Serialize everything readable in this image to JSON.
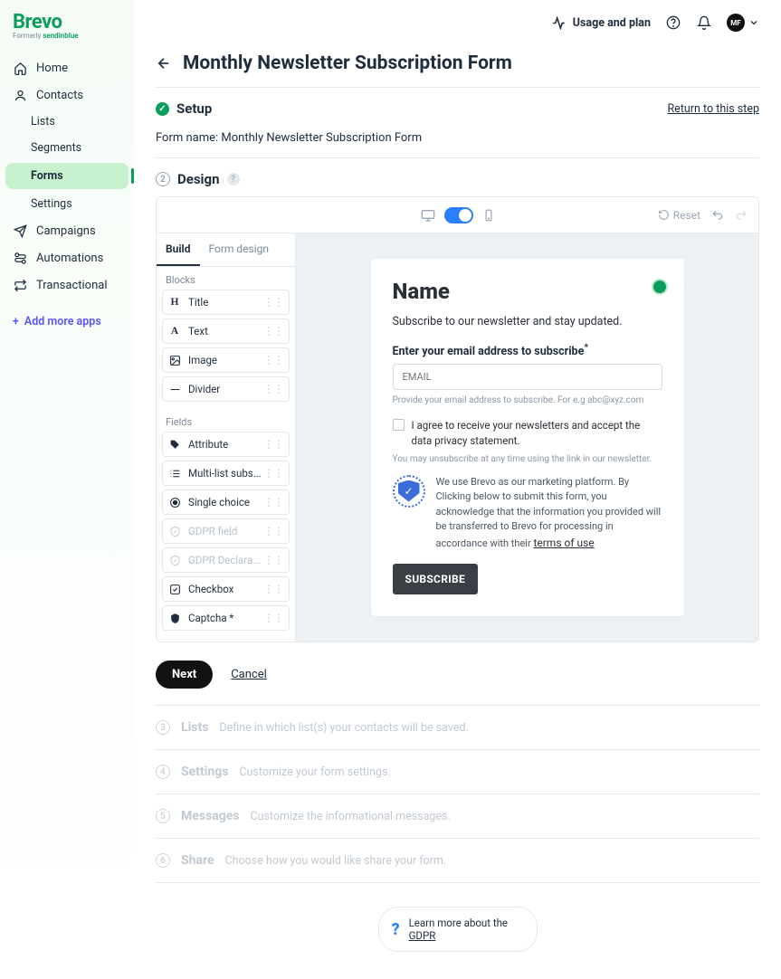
{
  "brand": {
    "name": "Brevo",
    "tagline_prefix": "Formerly ",
    "tagline_brand": "sendinblue"
  },
  "topbar": {
    "usage_label": "Usage and plan",
    "avatar_initials": "MF"
  },
  "sidebar": {
    "items": [
      {
        "label": "Home"
      },
      {
        "label": "Contacts"
      },
      {
        "label": "Lists"
      },
      {
        "label": "Segments"
      },
      {
        "label": "Forms"
      },
      {
        "label": "Settings"
      },
      {
        "label": "Campaigns"
      },
      {
        "label": "Automations"
      },
      {
        "label": "Transactional"
      }
    ],
    "add_apps": "Add more apps"
  },
  "page": {
    "title": "Monthly Newsletter Subscription Form",
    "setup_label": "Setup",
    "return_link": "Return to this step",
    "form_name_label": "Form name: ",
    "form_name_value": "Monthly Newsletter Subscription Form",
    "design_label": "Design",
    "reset_label": "Reset"
  },
  "builder": {
    "tabs": {
      "build": "Build",
      "form_design": "Form design"
    },
    "sections": {
      "blocks": "Blocks",
      "fields": "Fields"
    },
    "blocks": {
      "title": "Title",
      "text": "Text",
      "image": "Image",
      "divider": "Divider"
    },
    "fields": {
      "attribute": "Attribute",
      "multilist": "Multi-list subs...",
      "single_choice": "Single choice",
      "gdpr_field": "GDPR field",
      "gdpr_decl": "GDPR Declara...",
      "checkbox": "Checkbox",
      "captcha": "Captcha *"
    }
  },
  "form": {
    "title": "Name",
    "subtitle": "Subscribe to our newsletter and stay updated.",
    "email_label": "Enter your email address to subscribe",
    "email_placeholder": "EMAIL",
    "email_hint": "Provide your email address to subscribe. For e.g abc@xyz.com",
    "consent": "I agree to receive your newsletters and accept the data privacy statement.",
    "unsubscribe_note": "You may unsubscribe at any time using the link in our newsletter.",
    "gdpr_note": "We use Brevo as our marketing platform. By Clicking below to submit this form, you acknowledge that the information you provided will be transferred to Brevo for processing in accordance with their ",
    "terms_label": "terms of use",
    "subscribe": "SUBSCRIBE"
  },
  "footer": {
    "next": "Next",
    "cancel": "Cancel",
    "steps": [
      {
        "num": "3",
        "title": "Lists",
        "desc": "Define in which list(s) your contacts will be saved."
      },
      {
        "num": "4",
        "title": "Settings",
        "desc": "Customize your form settings."
      },
      {
        "num": "5",
        "title": "Messages",
        "desc": "Customize the informational messages."
      },
      {
        "num": "6",
        "title": "Share",
        "desc": "Choose how you would like share your form."
      }
    ],
    "gdpr_learn_prefix": "Learn more about the ",
    "gdpr_learn_link": "GDPR"
  }
}
